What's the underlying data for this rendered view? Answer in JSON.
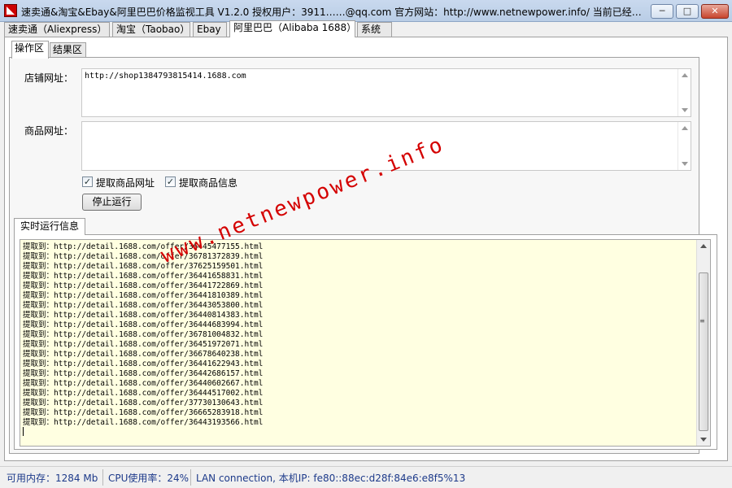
{
  "window": {
    "title": "速卖通&淘宝&Ebay&阿里巴巴价格监视工具 V1.2.0 授权用户：3911……@qq.com 官方网站：http://www.netnewpower.info/ 当前已经…",
    "minimize": "─",
    "maximize": "□",
    "close": "✕"
  },
  "tabs": [
    {
      "label": "速卖通（Aliexpress）"
    },
    {
      "label": "淘宝（Taobao）"
    },
    {
      "label": "Ebay"
    },
    {
      "label": "阿里巴巴（Alibaba 1688）"
    },
    {
      "label": "系统"
    }
  ],
  "subtabs": [
    {
      "label": "操作区"
    },
    {
      "label": "结果区"
    }
  ],
  "form": {
    "shop_url_label": "店铺网址：",
    "shop_url_value": "http://shop1384793815414.1688.com",
    "product_url_label": "商品网址：",
    "product_url_value": "",
    "check1_label": "提取商品网址",
    "check2_label": "提取商品信息",
    "check_mark": "✓",
    "stop_button": "停止运行"
  },
  "info": {
    "tab_label": "实时运行信息",
    "log_lines": [
      "提取到：http://detail.1688.com/offer/36445477155.html",
      "提取到：http://detail.1688.com/offer/36781372839.html",
      "提取到：http://detail.1688.com/offer/37625159501.html",
      "提取到：http://detail.1688.com/offer/36441658831.html",
      "提取到：http://detail.1688.com/offer/36441722869.html",
      "提取到：http://detail.1688.com/offer/36441810389.html",
      "提取到：http://detail.1688.com/offer/36443053800.html",
      "提取到：http://detail.1688.com/offer/36440814383.html",
      "提取到：http://detail.1688.com/offer/36444683994.html",
      "提取到：http://detail.1688.com/offer/36781004832.html",
      "提取到：http://detail.1688.com/offer/36451972071.html",
      "提取到：http://detail.1688.com/offer/36678640238.html",
      "提取到：http://detail.1688.com/offer/36441622943.html",
      "提取到：http://detail.1688.com/offer/36442686157.html",
      "提取到：http://detail.1688.com/offer/36440602667.html",
      "提取到：http://detail.1688.com/offer/36444517002.html",
      "提取到：http://detail.1688.com/offer/37730130643.html",
      "提取到：http://detail.1688.com/offer/36665283918.html",
      "提取到：http://detail.1688.com/offer/36443193566.html"
    ],
    "scroll_grip": "≡"
  },
  "watermark": "www.netnewpower.info",
  "statusbar": {
    "memory": "可用内存：1284 Mb",
    "cpu": "CPU使用率：24%",
    "network": "LAN connection, 本机IP: fe80::88ec:d28f:84e6:e8f5%13"
  }
}
